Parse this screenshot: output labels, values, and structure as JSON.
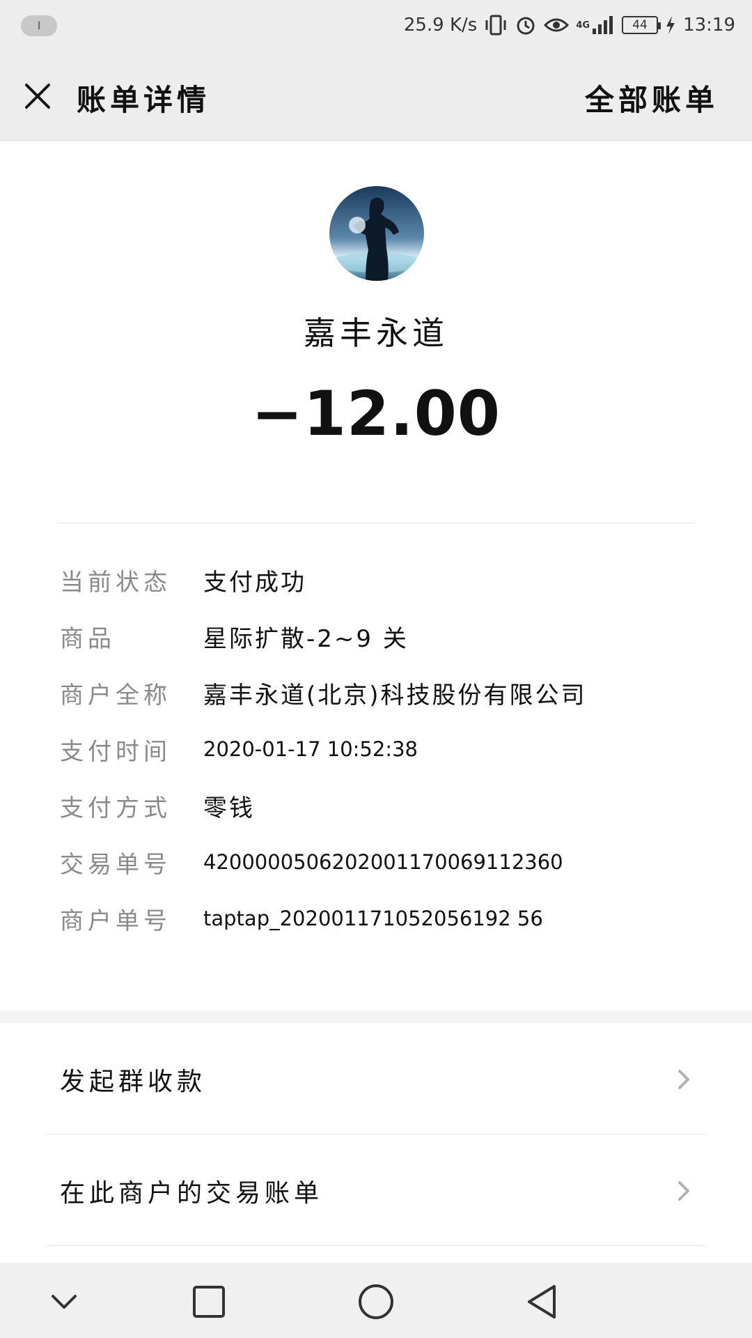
{
  "status_bar": {
    "pill_text": "I",
    "net_speed": "25.9 K/s",
    "network": "4G",
    "battery": "44",
    "time": "13:19"
  },
  "header": {
    "title": "账单详情",
    "right_link": "全部账单"
  },
  "summary": {
    "merchant": "嘉丰永道",
    "amount": "−12.00"
  },
  "details": [
    {
      "label": "当前状态",
      "value": "支付成功"
    },
    {
      "label": "商品",
      "value": "星际扩散-2~9 关"
    },
    {
      "label": "商户全称",
      "value": "嘉丰永道(北京)科技股份有限公司"
    },
    {
      "label": "支付时间",
      "value": "2020-01-17 10:52:38"
    },
    {
      "label": "支付方式",
      "value": "零钱"
    },
    {
      "label": "交易单号",
      "value": "4200000506202001170069112360"
    },
    {
      "label": "商户单号",
      "value": "taptap_202001171052056192 56"
    }
  ],
  "actions": [
    {
      "label": "发起群收款"
    },
    {
      "label": "在此商户的交易账单"
    }
  ],
  "colors": {
    "header_bg": "#ededed",
    "label_gray": "#8a8a8a",
    "text": "#111111"
  },
  "icons": [
    "close-icon",
    "chevron-right-icon",
    "nav-back-icon",
    "nav-home-icon",
    "nav-recents-icon",
    "nav-collapse-icon"
  ]
}
